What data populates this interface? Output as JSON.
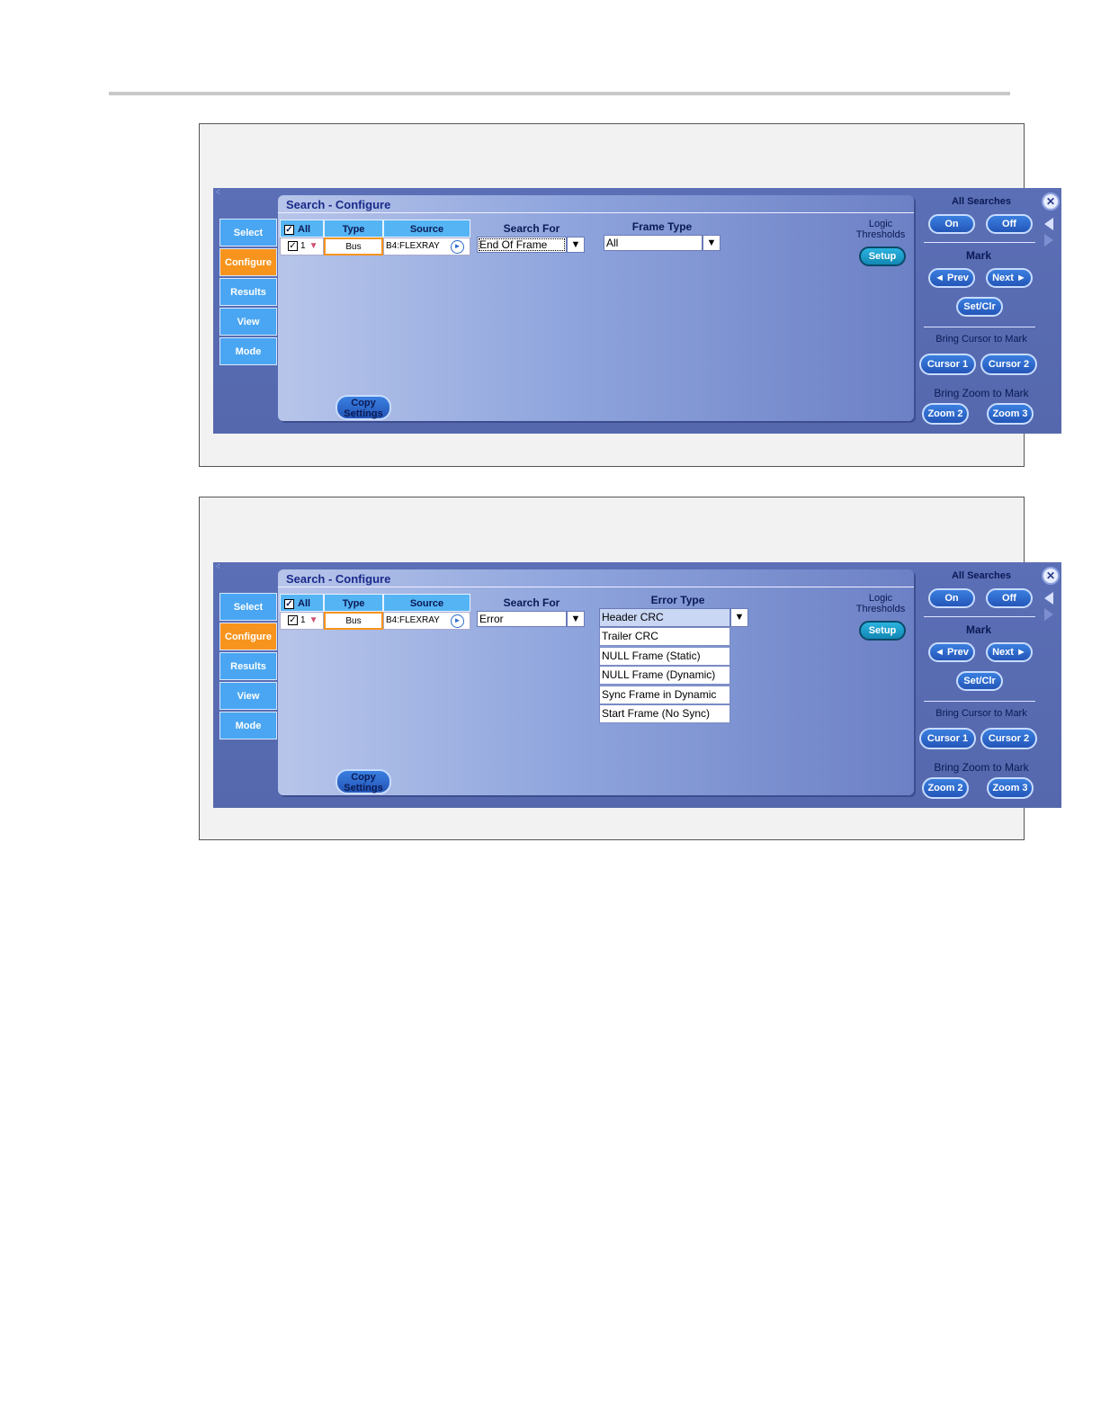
{
  "panels": [
    {
      "title": "Search - Configure",
      "tabs": [
        "Select",
        "Configure",
        "Results",
        "View",
        "Mode"
      ],
      "active_tab": "Configure",
      "table": {
        "headers": [
          "All",
          "Type",
          "Source"
        ],
        "row": {
          "num": "1",
          "type": "Bus",
          "source": "B4:FLEXRAY"
        }
      },
      "search_for_label": "Search For",
      "search_for_value": "End Of Frame",
      "type_label": "Frame Type",
      "type_value": "All",
      "logic_label": "Logic\nThresholds",
      "setup_label": "Setup",
      "copy_label": "Copy Settings",
      "list": []
    },
    {
      "title": "Search - Configure",
      "tabs": [
        "Select",
        "Configure",
        "Results",
        "View",
        "Mode"
      ],
      "active_tab": "Configure",
      "table": {
        "headers": [
          "All",
          "Type",
          "Source"
        ],
        "row": {
          "num": "1",
          "type": "Bus",
          "source": "B4:FLEXRAY"
        }
      },
      "search_for_label": "Search For",
      "search_for_value": "Error",
      "type_label": "Error Type",
      "type_value": "Header CRC",
      "logic_label": "Logic\nThresholds",
      "setup_label": "Setup",
      "copy_label": "Copy Settings",
      "list": [
        "Trailer CRC",
        "NULL Frame (Static)",
        "NULL Frame (Dynamic)",
        "Sync Frame in Dynamic",
        "Start Frame (No Sync)"
      ]
    }
  ],
  "right": {
    "all_searches": "All Searches",
    "on": "On",
    "off": "Off",
    "mark": "Mark",
    "prev": "◄ Prev",
    "next": "Next ►",
    "setclr": "Set/Clr",
    "bring_cursor": "Bring Cursor to Mark",
    "cursor1": "Cursor 1",
    "cursor2": "Cursor 2",
    "bring_zoom": "Bring Zoom to Mark",
    "zoom2": "Zoom 2",
    "zoom3": "Zoom 3"
  },
  "colors": {
    "panel_bg": "#5568ad",
    "tab_blue": "#4aa6f2",
    "tab_active": "#f7941d"
  }
}
